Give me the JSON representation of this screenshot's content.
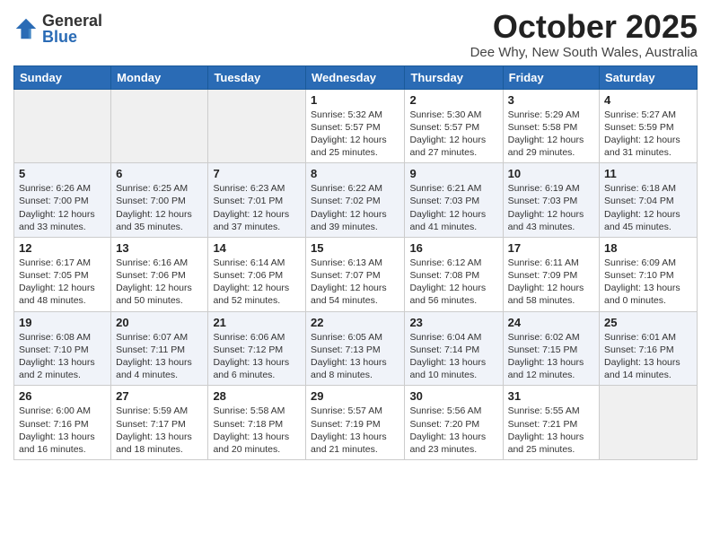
{
  "header": {
    "logo_general": "General",
    "logo_blue": "Blue",
    "month_title": "October 2025",
    "location": "Dee Why, New South Wales, Australia"
  },
  "days_of_week": [
    "Sunday",
    "Monday",
    "Tuesday",
    "Wednesday",
    "Thursday",
    "Friday",
    "Saturday"
  ],
  "weeks": [
    [
      {
        "day": "",
        "info": ""
      },
      {
        "day": "",
        "info": ""
      },
      {
        "day": "",
        "info": ""
      },
      {
        "day": "1",
        "info": "Sunrise: 5:32 AM\nSunset: 5:57 PM\nDaylight: 12 hours\nand 25 minutes."
      },
      {
        "day": "2",
        "info": "Sunrise: 5:30 AM\nSunset: 5:57 PM\nDaylight: 12 hours\nand 27 minutes."
      },
      {
        "day": "3",
        "info": "Sunrise: 5:29 AM\nSunset: 5:58 PM\nDaylight: 12 hours\nand 29 minutes."
      },
      {
        "day": "4",
        "info": "Sunrise: 5:27 AM\nSunset: 5:59 PM\nDaylight: 12 hours\nand 31 minutes."
      }
    ],
    [
      {
        "day": "5",
        "info": "Sunrise: 6:26 AM\nSunset: 7:00 PM\nDaylight: 12 hours\nand 33 minutes."
      },
      {
        "day": "6",
        "info": "Sunrise: 6:25 AM\nSunset: 7:00 PM\nDaylight: 12 hours\nand 35 minutes."
      },
      {
        "day": "7",
        "info": "Sunrise: 6:23 AM\nSunset: 7:01 PM\nDaylight: 12 hours\nand 37 minutes."
      },
      {
        "day": "8",
        "info": "Sunrise: 6:22 AM\nSunset: 7:02 PM\nDaylight: 12 hours\nand 39 minutes."
      },
      {
        "day": "9",
        "info": "Sunrise: 6:21 AM\nSunset: 7:03 PM\nDaylight: 12 hours\nand 41 minutes."
      },
      {
        "day": "10",
        "info": "Sunrise: 6:19 AM\nSunset: 7:03 PM\nDaylight: 12 hours\nand 43 minutes."
      },
      {
        "day": "11",
        "info": "Sunrise: 6:18 AM\nSunset: 7:04 PM\nDaylight: 12 hours\nand 45 minutes."
      }
    ],
    [
      {
        "day": "12",
        "info": "Sunrise: 6:17 AM\nSunset: 7:05 PM\nDaylight: 12 hours\nand 48 minutes."
      },
      {
        "day": "13",
        "info": "Sunrise: 6:16 AM\nSunset: 7:06 PM\nDaylight: 12 hours\nand 50 minutes."
      },
      {
        "day": "14",
        "info": "Sunrise: 6:14 AM\nSunset: 7:06 PM\nDaylight: 12 hours\nand 52 minutes."
      },
      {
        "day": "15",
        "info": "Sunrise: 6:13 AM\nSunset: 7:07 PM\nDaylight: 12 hours\nand 54 minutes."
      },
      {
        "day": "16",
        "info": "Sunrise: 6:12 AM\nSunset: 7:08 PM\nDaylight: 12 hours\nand 56 minutes."
      },
      {
        "day": "17",
        "info": "Sunrise: 6:11 AM\nSunset: 7:09 PM\nDaylight: 12 hours\nand 58 minutes."
      },
      {
        "day": "18",
        "info": "Sunrise: 6:09 AM\nSunset: 7:10 PM\nDaylight: 13 hours\nand 0 minutes."
      }
    ],
    [
      {
        "day": "19",
        "info": "Sunrise: 6:08 AM\nSunset: 7:10 PM\nDaylight: 13 hours\nand 2 minutes."
      },
      {
        "day": "20",
        "info": "Sunrise: 6:07 AM\nSunset: 7:11 PM\nDaylight: 13 hours\nand 4 minutes."
      },
      {
        "day": "21",
        "info": "Sunrise: 6:06 AM\nSunset: 7:12 PM\nDaylight: 13 hours\nand 6 minutes."
      },
      {
        "day": "22",
        "info": "Sunrise: 6:05 AM\nSunset: 7:13 PM\nDaylight: 13 hours\nand 8 minutes."
      },
      {
        "day": "23",
        "info": "Sunrise: 6:04 AM\nSunset: 7:14 PM\nDaylight: 13 hours\nand 10 minutes."
      },
      {
        "day": "24",
        "info": "Sunrise: 6:02 AM\nSunset: 7:15 PM\nDaylight: 13 hours\nand 12 minutes."
      },
      {
        "day": "25",
        "info": "Sunrise: 6:01 AM\nSunset: 7:16 PM\nDaylight: 13 hours\nand 14 minutes."
      }
    ],
    [
      {
        "day": "26",
        "info": "Sunrise: 6:00 AM\nSunset: 7:16 PM\nDaylight: 13 hours\nand 16 minutes."
      },
      {
        "day": "27",
        "info": "Sunrise: 5:59 AM\nSunset: 7:17 PM\nDaylight: 13 hours\nand 18 minutes."
      },
      {
        "day": "28",
        "info": "Sunrise: 5:58 AM\nSunset: 7:18 PM\nDaylight: 13 hours\nand 20 minutes."
      },
      {
        "day": "29",
        "info": "Sunrise: 5:57 AM\nSunset: 7:19 PM\nDaylight: 13 hours\nand 21 minutes."
      },
      {
        "day": "30",
        "info": "Sunrise: 5:56 AM\nSunset: 7:20 PM\nDaylight: 13 hours\nand 23 minutes."
      },
      {
        "day": "31",
        "info": "Sunrise: 5:55 AM\nSunset: 7:21 PM\nDaylight: 13 hours\nand 25 minutes."
      },
      {
        "day": "",
        "info": ""
      }
    ]
  ]
}
